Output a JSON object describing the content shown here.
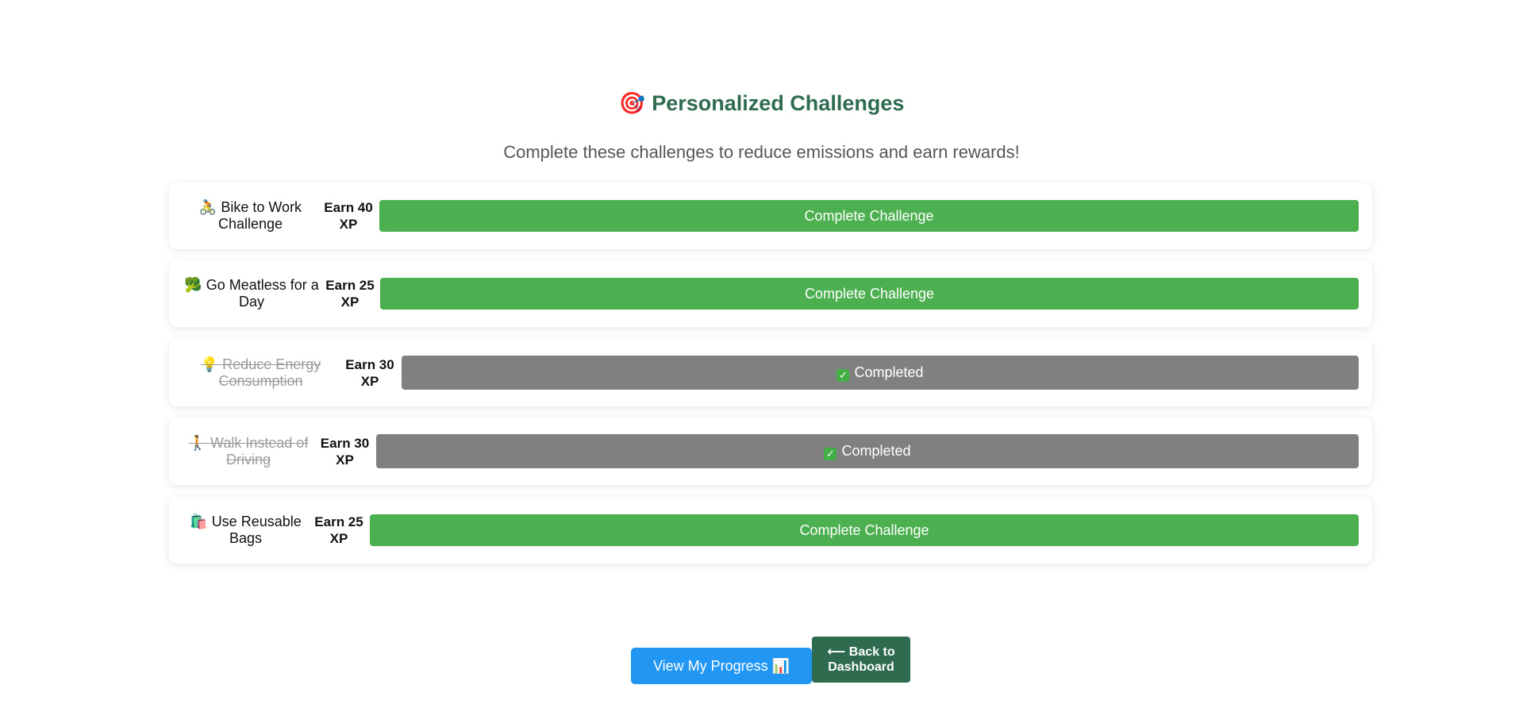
{
  "header": {
    "title_icon": "🎯",
    "title": "Personalized Challenges",
    "subtitle": "Complete these challenges to reduce emissions and earn rewards!"
  },
  "challenges": [
    {
      "icon": "🚴",
      "name": "Bike to Work Challenge",
      "xp": "Earn 40 XP",
      "status": "open",
      "action_label": "Complete Challenge"
    },
    {
      "icon": "🥦",
      "name": "Go Meatless for a Day",
      "xp": "Earn 25 XP",
      "status": "open",
      "action_label": "Complete Challenge"
    },
    {
      "icon": "💡",
      "name": "Reduce Energy Consumption",
      "xp": "Earn 30 XP",
      "status": "completed",
      "action_label": "Completed"
    },
    {
      "icon": "🚶",
      "name": "Walk Instead of Driving",
      "xp": "Earn 30 XP",
      "status": "completed",
      "action_label": "Completed"
    },
    {
      "icon": "🛍️",
      "name": "Use Reusable Bags",
      "xp": "Earn 25 XP",
      "status": "open",
      "action_label": "Complete Challenge"
    }
  ],
  "completed_check": "✓",
  "footer": {
    "progress_label": "View My Progress 📊",
    "back_label": "⟵ Back to Dashboard"
  },
  "colors": {
    "accent_green": "#4caf50",
    "heading_green": "#2e6b4f",
    "completed_gray": "#808080",
    "progress_blue": "#2196f3"
  }
}
